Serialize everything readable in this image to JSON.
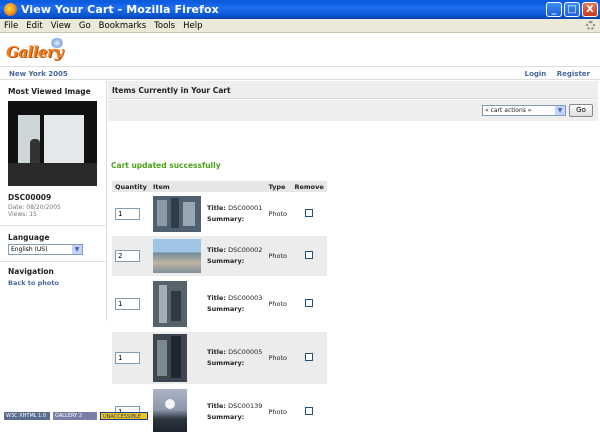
{
  "window": {
    "title": "View Your Cart - Mozilla Firefox",
    "minimize": "_",
    "maximize": "□",
    "close": "X"
  },
  "menu": [
    "File",
    "Edit",
    "View",
    "Go",
    "Bookmarks",
    "Tools",
    "Help"
  ],
  "site": {
    "logo_text": "Gallery",
    "breadcrumb": "New York 2005",
    "login": "Login",
    "register": "Register"
  },
  "sidebar": {
    "most_viewed_heading": "Most Viewed Image",
    "image_title": "DSC00009",
    "date": "Date: 08/20/2005",
    "views": "Views: 15",
    "language_heading": "Language",
    "language_value": "English (US)",
    "navigation_heading": "Navigation",
    "back_link": "Back to photo"
  },
  "main": {
    "heading": "Items Currently in Your Cart",
    "actions_select": "« cart actions »",
    "go_label": "Go",
    "status_message": "Cart updated successfully",
    "columns": [
      "Quantity",
      "Item",
      "",
      "Type",
      "Remove"
    ],
    "title_label": "Title:",
    "summary_label": "Summary:",
    "items": [
      {
        "quantity": "1",
        "title": "DSC00001",
        "type": "Photo"
      },
      {
        "quantity": "2",
        "title": "DSC00002",
        "type": "Photo"
      },
      {
        "quantity": "1",
        "title": "DSC00003",
        "type": "Photo"
      },
      {
        "quantity": "1",
        "title": "DSC00005",
        "type": "Photo"
      },
      {
        "quantity": "1",
        "title": "DSC00139",
        "type": "Photo"
      }
    ]
  },
  "footer_badges": [
    "W3C XHTML 1.0",
    "GALLERY 2",
    "UNACCESSIBLE"
  ],
  "colors": {
    "link": "#44689b",
    "success": "#4ca41b",
    "titlebar": "#0d5ae0"
  }
}
